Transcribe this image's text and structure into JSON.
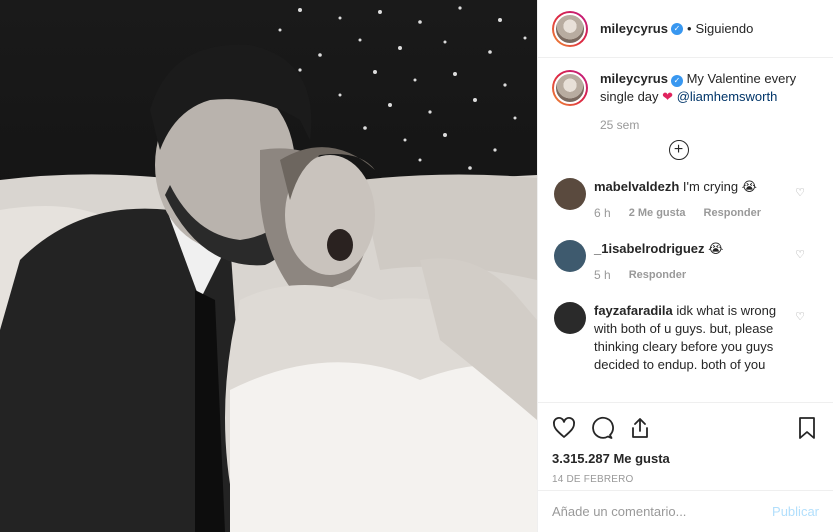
{
  "post": {
    "username": "mileycyrus",
    "follow_status": "Siguiendo",
    "separator": "•"
  },
  "caption": {
    "username": "mileycyrus",
    "text": "My Valentine every single day",
    "emoji": "❤",
    "mention": "@liamhemsworth",
    "time": "25 sem"
  },
  "comments": [
    {
      "username": "mabelvaldezh",
      "text": "I'm crying",
      "emoji": "😭",
      "time": "6 h",
      "likes": "2 Me gusta",
      "reply": "Responder",
      "avatar_color": "#5a4a3e"
    },
    {
      "username": "_1isabelrodriguez",
      "text": "",
      "emoji": "😭",
      "time": "5 h",
      "likes": "",
      "reply": "Responder",
      "avatar_color": "#3e5a6e"
    },
    {
      "username": "fayzafaradila",
      "text": "idk what is wrong with both of u guys. but, please thinking cleary before you guys decided to endup. both of you",
      "emoji": "",
      "time": "",
      "likes": "",
      "reply": "",
      "avatar_color": "#2a2a2a"
    }
  ],
  "actions": {
    "like_count": "3.315.287 Me gusta",
    "date": "14 DE FEBRERO"
  },
  "add_comment": {
    "placeholder": "Añade un comentario...",
    "post_label": "Publicar"
  }
}
